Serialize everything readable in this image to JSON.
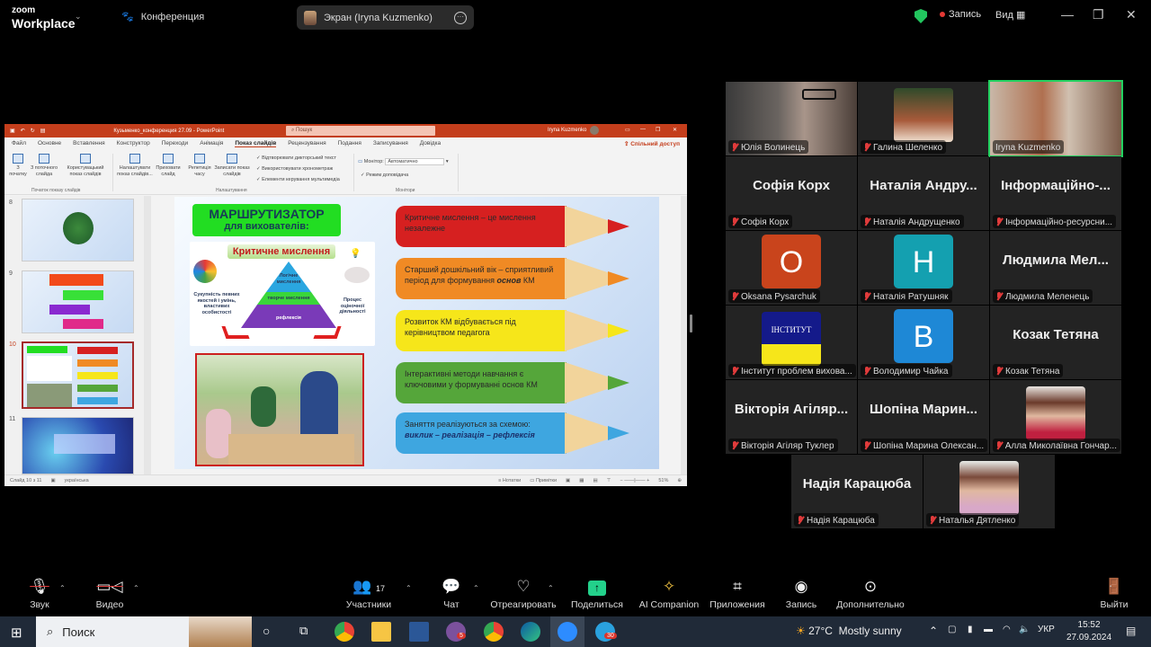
{
  "zoom": {
    "logo_small": "zoom",
    "logo_large": "Workplace",
    "meeting_label": "Конференция",
    "share_indicator": "Экран (Iryna Kuzmenko)",
    "recording_label": "Запись",
    "view_label": "Вид",
    "security_color": "#22c55e",
    "active_speaker_color": "#23d160"
  },
  "ppt": {
    "title": "Кузьменко_конференция 27.09  -  PowerPoint",
    "search_placeholder": "Пошук",
    "user": "Iryna Kuzmenko",
    "accent": "#c43e1c",
    "menu": [
      "Файл",
      "Основне",
      "Вставлення",
      "Конструктор",
      "Переходи",
      "Анімація",
      "Показ слайдів",
      "Рецензування",
      "Подання",
      "Записування",
      "Довідка"
    ],
    "active_menu": "Показ слайдів",
    "share_label": "Спільний доступ",
    "ribbon": {
      "from_start": "З початку",
      "from_current": "З поточного слайда",
      "custom_show": "Користувацький показ слайдів",
      "group_start": "Початок показу слайдів",
      "setup_show": "Налаштувати показ слайдів...",
      "hide_slide": "Приховати слайд",
      "rehearse": "Репетиція часу",
      "record": "Записати показ слайдів",
      "check_narration": "Відтворювати дикторський текст",
      "check_timings": "Використовувати хронометраж",
      "check_media": "Елементи керування мультимедіа",
      "group_setup": "Налаштування",
      "monitor_label": "Монітор:",
      "monitor_value": "Автоматично",
      "presenter_view": "Режим доповідача",
      "group_monitors": "Монітори"
    },
    "thumbnails": [
      {
        "num": "8"
      },
      {
        "num": "9"
      },
      {
        "num": "10",
        "selected": true
      },
      {
        "num": "11"
      }
    ],
    "slide": {
      "title1": "МАРШРУТИЗАТОР",
      "title2": "для вихователів:",
      "diagram_title": "Критичне мислення",
      "pyramid": [
        "Логічне мислення",
        "творче мислення",
        "рефлексія"
      ],
      "left_text": "Сукупність певних якостей і умінь, властивих особистості",
      "right_text": "Процес оціночної діяльності",
      "pencils": [
        {
          "text": "Критичне мислення – це мислення незалежне",
          "color": "#d62020",
          "tip": "#d62020"
        },
        {
          "text": "Старший дошкільний вік – сприятливий період для формування",
          "bold_italic": "основ",
          "suffix": " КМ",
          "color": "#f08a24",
          "tip": "#f08a24"
        },
        {
          "text": "Розвиток КМ відбувається під керівництвом педагога",
          "color": "#f6e61a",
          "tip": "#f6e61a"
        },
        {
          "text": "Інтерактивні методи навчання є ключовими у формуванні основ КМ",
          "color": "#55a63a",
          "tip": "#55a63a"
        },
        {
          "text": "Заняття реалізуються за схемою:",
          "italic_line": "виклик – реалізація – рефлексія",
          "color": "#3ea6e0",
          "tip": "#3ea6e0"
        }
      ]
    },
    "status": {
      "slide_counter": "Слайд 10 з 11",
      "language": "українська",
      "notes": "Нотатки",
      "comments": "Примітки",
      "zoom": "51%"
    }
  },
  "participants": [
    {
      "display": "Юлія Волинець",
      "type": "video"
    },
    {
      "display": "Галина Шеленко",
      "type": "photo"
    },
    {
      "display": "Iryna Kuzmenko",
      "type": "video",
      "active": true,
      "unmuted": true
    },
    {
      "display": "Софія Корх",
      "big": "Софія Корх",
      "type": "name"
    },
    {
      "display": "Наталія Андрущенко",
      "big": "Наталія Андру...",
      "type": "name"
    },
    {
      "display": "Інформаційно-ресурсни...",
      "big": "Інформаційно-...",
      "type": "name"
    },
    {
      "display": "Oksana Pysarchuk",
      "letter": "O",
      "color": "#c9441c",
      "type": "letter"
    },
    {
      "display": "Наталія Ратушняк",
      "letter": "Н",
      "color": "#14a0b0",
      "type": "letter"
    },
    {
      "display": "Людмила Меленець",
      "big": "Людмила  Мел...",
      "type": "name"
    },
    {
      "display": "Інститут проблем вихова...",
      "logo_text": "ІНСТИТУТ",
      "type": "logo"
    },
    {
      "display": "Володимир Чайка",
      "letter": "В",
      "color": "#1e88d6",
      "type": "letter"
    },
    {
      "display": "Козак Тетяна",
      "big": "Козак Тетяна",
      "type": "name"
    },
    {
      "display": "Вікторія Агіляр Туклер",
      "big": "Вікторія Агіляр...",
      "type": "name"
    },
    {
      "display": "Шопіна Марина Олексан...",
      "big": "Шопіна  Марин...",
      "type": "name"
    },
    {
      "display": "Алла Миколаївна Гончар...",
      "type": "photo"
    },
    {
      "display": "Надія Карацюба",
      "big": "Надія Карацюба",
      "type": "name"
    },
    {
      "display": "Наталья Дятленко",
      "type": "photo"
    }
  ],
  "toolbar": {
    "audio": "Звук",
    "video": "Видео",
    "participants": "Участники",
    "participants_count": "17",
    "chat": "Чат",
    "react": "Отреагировать",
    "share": "Поделиться",
    "ai": "AI Companion",
    "apps": "Приложения",
    "record": "Запись",
    "more": "Дополнительно",
    "leave": "Выйти",
    "share_color": "#23d18b"
  },
  "taskbar": {
    "search": "Поиск",
    "viber_badge": "5",
    "telegram_badge": "30",
    "weather_temp": "27°C",
    "weather_text": "Mostly sunny",
    "lang": "УКР",
    "time": "15:52",
    "date": "27.09.2024"
  }
}
